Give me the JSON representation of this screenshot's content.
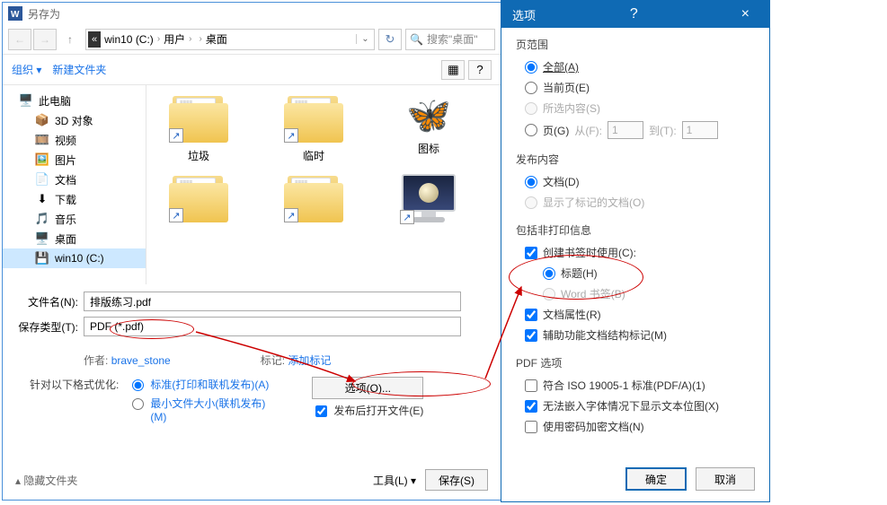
{
  "saveDialog": {
    "title": "另存为",
    "path": {
      "drive": "win10 (C:)",
      "crumbs": [
        "用户",
        " ",
        "桌面"
      ]
    },
    "searchPlaceholder": "搜索\"桌面\"",
    "organize": "组织 ▾",
    "newFolder": "新建文件夹",
    "tree": [
      {
        "label": "此电脑",
        "icon": "monitor"
      },
      {
        "label": "3D 对象",
        "icon": "cube",
        "sub": true
      },
      {
        "label": "视频",
        "icon": "video",
        "sub": true
      },
      {
        "label": "图片",
        "icon": "image",
        "sub": true
      },
      {
        "label": "文档",
        "icon": "doc",
        "sub": true
      },
      {
        "label": "下载",
        "icon": "download",
        "sub": true
      },
      {
        "label": "音乐",
        "icon": "music",
        "sub": true
      },
      {
        "label": "桌面",
        "icon": "desktop",
        "sub": true
      },
      {
        "label": "win10 (C:)",
        "icon": "drive",
        "sub": true,
        "sel": true
      }
    ],
    "files": [
      {
        "label": "垃圾",
        "type": "folder-link"
      },
      {
        "label": "临时",
        "type": "folder-link"
      },
      {
        "label": "图标",
        "type": "butterfly"
      },
      {
        "label": "",
        "type": "folder-link"
      },
      {
        "label": "",
        "type": "folder-link"
      },
      {
        "label": "",
        "type": "monitor-link"
      }
    ],
    "fileNameLabel": "文件名(N):",
    "fileName": "排版练习.pdf",
    "fileTypeLabel": "保存类型(T):",
    "fileType": "PDF (*.pdf)",
    "authorLabel": "作者:",
    "author": "brave_stone",
    "tagLabel": "标记:",
    "tag": "添加标记",
    "optimizeLabel": "针对以下格式优化:",
    "optStd": "标准(打印和联机发布)(A)",
    "optMin": "最小文件大小(联机发布)(M)",
    "optionsBtn": "选项(O)...",
    "openAfter": "发布后打开文件(E)",
    "hideFolders": "隐藏文件夹",
    "tools": "工具(L)",
    "saveBtn": "保存(S)"
  },
  "optDialog": {
    "title": "选项",
    "pageRange": {
      "title": "页范围",
      "all": "全部(A)",
      "current": "当前页(E)",
      "selection": "所选内容(S)",
      "pages": "页(G)",
      "fromLbl": "从(F):",
      "from": "1",
      "toLbl": "到(T):",
      "to": "1"
    },
    "publish": {
      "title": "发布内容",
      "doc": "文档(D)",
      "marked": "显示了标记的文档(O)"
    },
    "nonprint": {
      "title": "包括非打印信息",
      "bookmarks": "创建书签时使用(C):",
      "headings": "标题(H)",
      "wordBm": "Word 书签(B)",
      "props": "文档属性(R)",
      "a11y": "辅助功能文档结构标记(M)"
    },
    "pdf": {
      "title": "PDF 选项",
      "iso": "符合 ISO 19005-1 标准(PDF/A)(1)",
      "bitmap": "无法嵌入字体情况下显示文本位图(X)",
      "encrypt": "使用密码加密文档(N)"
    },
    "ok": "确定",
    "cancel": "取消"
  }
}
